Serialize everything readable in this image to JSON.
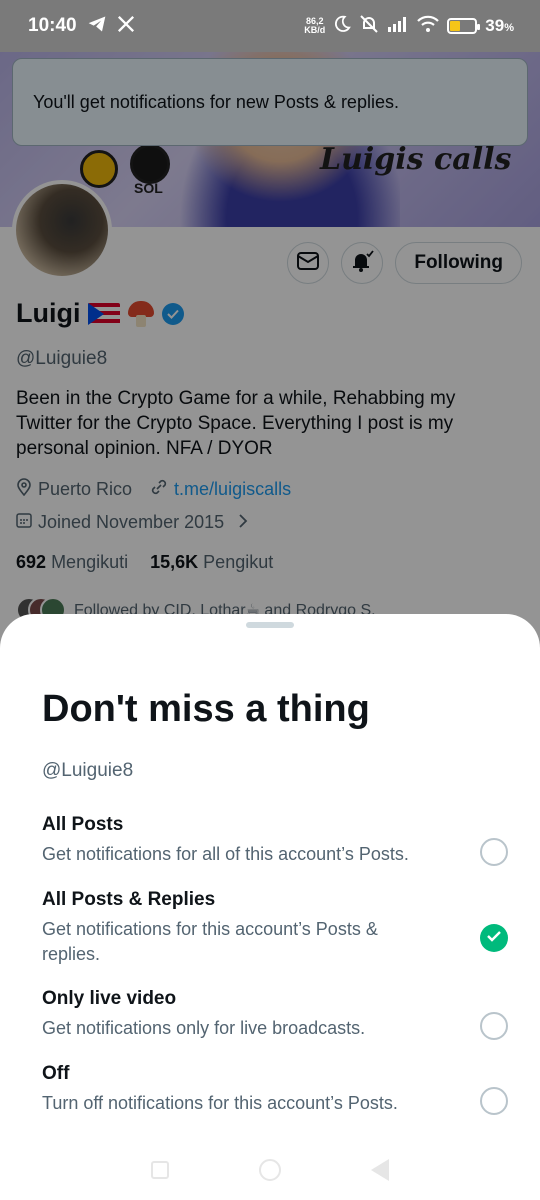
{
  "status_bar": {
    "time": "10:40",
    "speed_value": "86,2",
    "speed_unit": "KB/d",
    "battery_pct": "39",
    "battery_level": 0.39,
    "battery_suffix": "%"
  },
  "toast": {
    "text": "You'll get notifications for new Posts & replies."
  },
  "profile": {
    "banner_text": "Luigis calls",
    "banner_coin_text": "SOL",
    "name": "Luigi",
    "handle": "@Luiguie8",
    "bio": "Been in the Crypto Game for a while, Rehabbing my Twitter for the Crypto Space. Everything I post is my personal opinion. NFA / DYOR",
    "location": "Puerto Rico",
    "link": "t.me/luigiscalls",
    "joined": "Joined November 2015",
    "following_count": "692",
    "following_label": "Mengikuti",
    "followers_count": "15,6K",
    "followers_label": "Pengikut",
    "followed_by": "Followed by CID, Lothar☕ and Rodrygo S.",
    "follow_button": "Following"
  },
  "sheet": {
    "title": "Don't miss a thing",
    "handle": "@Luiguie8",
    "options": [
      {
        "title": "All Posts",
        "desc": "Get notifications for all of this account’s Posts.",
        "selected": false
      },
      {
        "title": "All Posts & Replies",
        "desc": "Get notifications for this account’s Posts & replies.",
        "selected": true
      },
      {
        "title": "Only live video",
        "desc": "Get notifications only for live broadcasts.",
        "selected": false
      },
      {
        "title": "Off",
        "desc": "Turn off notifications for this account’s Posts.",
        "selected": false
      }
    ]
  },
  "colors": {
    "accent": "#1d9bf0",
    "selected": "#00ba7c",
    "text": "#0f1419",
    "muted": "#536471"
  }
}
